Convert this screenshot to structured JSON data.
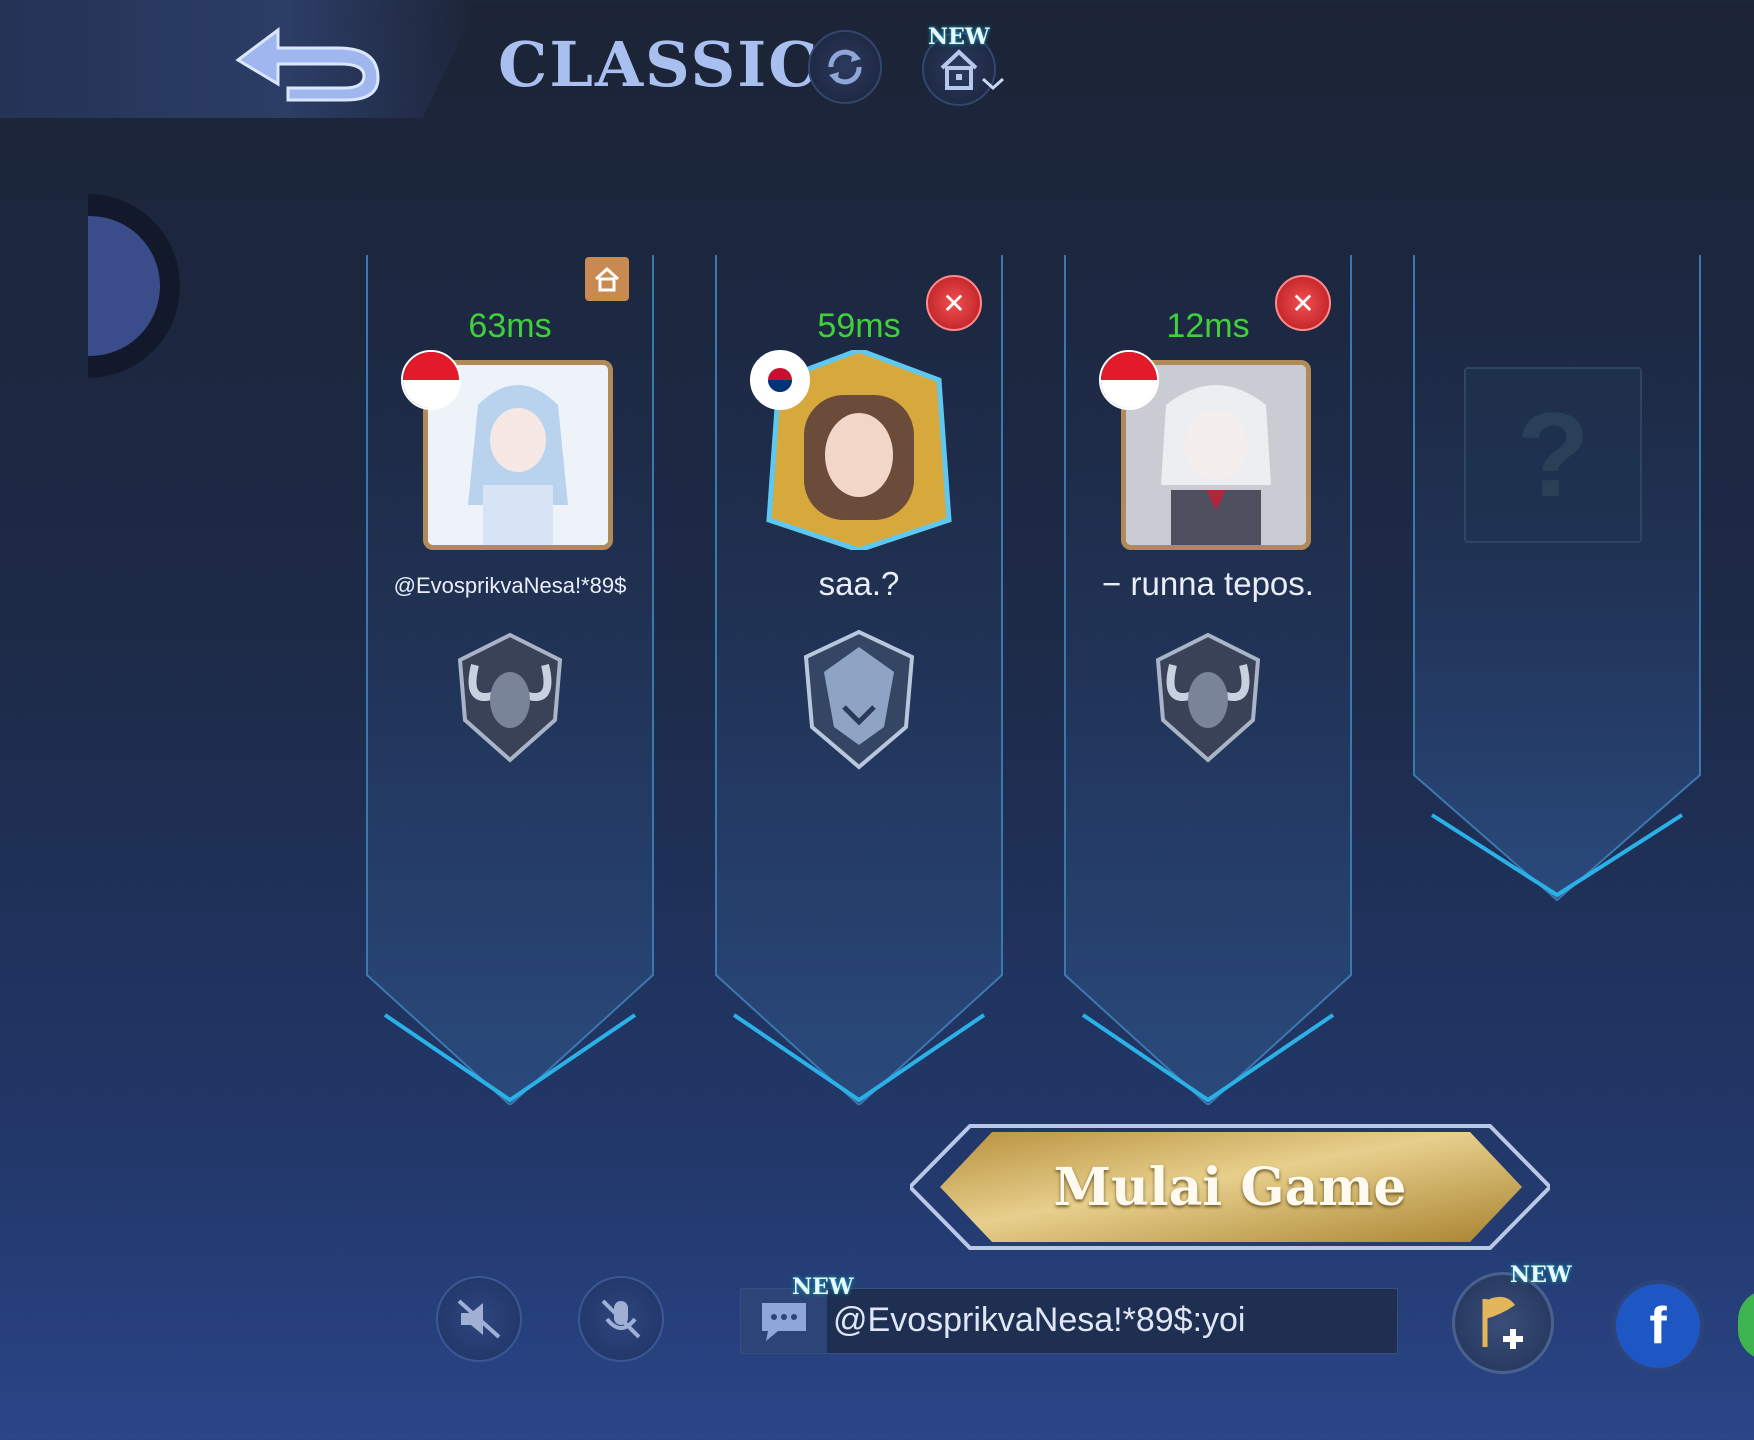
{
  "header": {
    "title": "CLASSIC",
    "room_new_badge": "NEW"
  },
  "players": [
    {
      "ping": "63ms",
      "name": "@EvosprikvaNesa!*89$",
      "flag": "indonesia",
      "role": "host",
      "rank_icon": "ram-rank-emblem"
    },
    {
      "ping": "59ms",
      "name": "saa.?",
      "flag": "south-korea",
      "role": "member",
      "rank_icon": "wolf-rank-emblem"
    },
    {
      "ping": "12ms",
      "name": "− runna tepos.",
      "flag": "indonesia",
      "role": "member",
      "rank_icon": "ram-rank-emblem"
    },
    {
      "empty_slot_symbol": "?"
    }
  ],
  "actions": {
    "start_label": "Mulai Game"
  },
  "bottom": {
    "chat_new_badge": "NEW",
    "chat_message": "@EvosprikvaNesa!*89$:yoi",
    "invite_new_badge": "NEW",
    "facebook_label": "f"
  },
  "colors": {
    "ping_green": "#40d13a",
    "title_blue": "#a9bff0",
    "kick_red": "#d8333a",
    "start_gold": "#d9b661"
  }
}
